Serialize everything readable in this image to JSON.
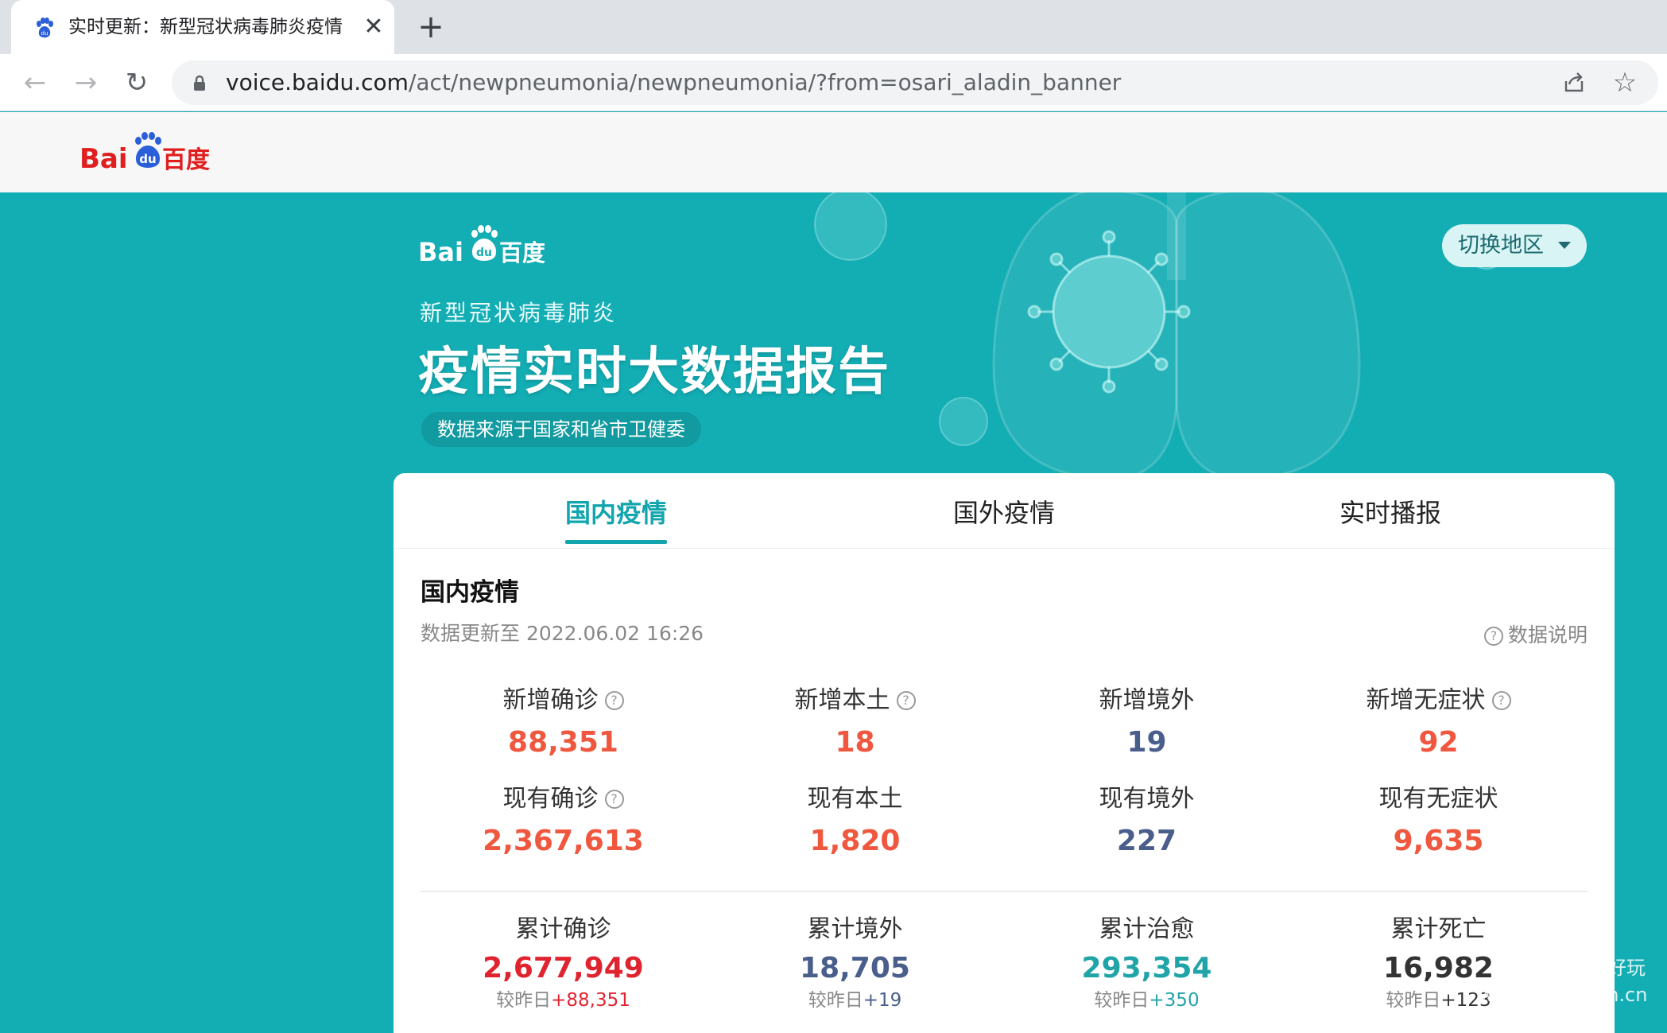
{
  "browser": {
    "tab_title": "实时更新：新型冠状病毒肺炎疫情",
    "tab_close": "✕",
    "new_tab": "+",
    "url_host": "voice.baidu.com",
    "url_path": "/act/newpneumonia/newpneumonia/?from=osari_aladin_banner"
  },
  "header": {
    "logo_text": "Bai百度"
  },
  "hero": {
    "logo_text": "Bai百度",
    "subtitle": "新型冠状病毒肺炎",
    "title": "疫情实时大数据报告",
    "source": "数据来源于国家和省市卫健委",
    "region_switch": "切换地区"
  },
  "card": {
    "tabs": [
      {
        "label": "国内疫情",
        "active": true
      },
      {
        "label": "国外疫情",
        "active": false
      },
      {
        "label": "实时播报",
        "active": false
      }
    ],
    "section_title": "国内疫情",
    "update_time": "数据更新至 2022.06.02 16:26",
    "data_note": "数据说明",
    "stats_row1": [
      {
        "label": "新增确诊",
        "value": "88,351",
        "help": true
      },
      {
        "label": "新增本土",
        "value": "18",
        "help": true
      },
      {
        "label": "新增境外",
        "value": "19",
        "help": false
      },
      {
        "label": "新增无症状",
        "value": "92",
        "help": true
      }
    ],
    "stats_row2": [
      {
        "label": "现有确诊",
        "value": "2,367,613",
        "help": true
      },
      {
        "label": "现有本土",
        "value": "1,820",
        "help": false
      },
      {
        "label": "现有境外",
        "value": "227",
        "help": false
      },
      {
        "label": "现有无症状",
        "value": "9,635",
        "help": false
      }
    ],
    "stats_row3": [
      {
        "label": "累计确诊",
        "value": "2,677,949",
        "delta_prefix": "较昨日",
        "delta": "+88,351"
      },
      {
        "label": "累计境外",
        "value": "18,705",
        "delta_prefix": "较昨日",
        "delta": "+19"
      },
      {
        "label": "累计治愈",
        "value": "293,354",
        "delta_prefix": "较昨日",
        "delta": "+350"
      },
      {
        "label": "累计死亡",
        "value": "16,982",
        "delta_prefix": "较昨日",
        "delta": "+123"
      }
    ]
  },
  "watermark": {
    "line1": "数据好玩",
    "line2": "www.dataisfun.cn"
  },
  "colors": {
    "teal": "#13adb4",
    "orange_red": "#f0573f",
    "navy": "#4a5e8c",
    "red": "#e0242f",
    "teal_value": "#21a4a8",
    "dark": "#333333"
  }
}
